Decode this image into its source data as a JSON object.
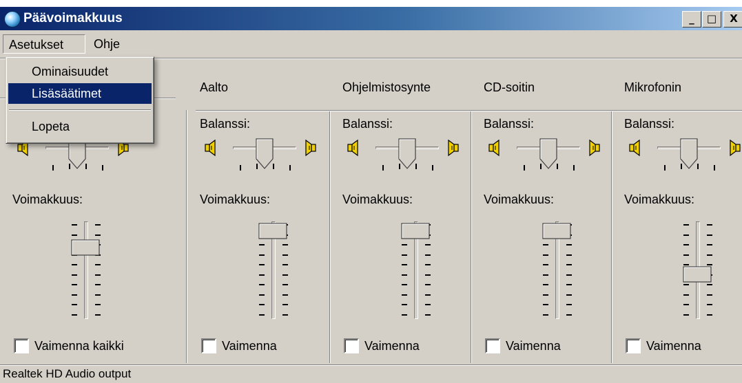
{
  "window": {
    "title": "Päävoimakkuus",
    "controls": {
      "minimize": "_",
      "maximize": "□",
      "close": "X"
    }
  },
  "menubar": {
    "items": [
      {
        "label": "Asetukset"
      },
      {
        "label": "Ohje"
      }
    ]
  },
  "dropdown": {
    "items": [
      {
        "label": "Ominaisuudet",
        "selected": false
      },
      {
        "label": "Lisäsäätimet",
        "selected": true
      },
      {
        "label": "Lopeta",
        "selected": false
      }
    ]
  },
  "labels": {
    "balance": "Balanssi:",
    "volume": "Voimakkuus:"
  },
  "channels": [
    {
      "name": "",
      "balance": 0.0,
      "volume": 0.78,
      "mute_label": "Vaimenna kaikki",
      "muted": false
    },
    {
      "name": "Aalto",
      "balance": 0.0,
      "volume": 0.98,
      "mute_label": "Vaimenna",
      "muted": false
    },
    {
      "name": "Ohjelmistosynte",
      "balance": 0.0,
      "volume": 0.98,
      "mute_label": "Vaimenna",
      "muted": false
    },
    {
      "name": "CD-soitin",
      "balance": 0.0,
      "volume": 0.98,
      "mute_label": "Vaimenna",
      "muted": false
    },
    {
      "name": "Mikrofonin",
      "balance": 0.0,
      "volume": 0.45,
      "mute_label": "Vaimenna",
      "muted": false
    }
  ],
  "statusbar": {
    "text": "Realtek HD Audio output"
  },
  "colors": {
    "titlebar_start": "#0a246a",
    "titlebar_end": "#a6caf0",
    "face": "#d4d0c8",
    "selection": "#0a246a",
    "speaker": "#f0d000"
  },
  "icons": {
    "app": "volume-globe-icon",
    "speaker_left": "speaker-left-icon",
    "speaker_right": "speaker-right-icon"
  }
}
